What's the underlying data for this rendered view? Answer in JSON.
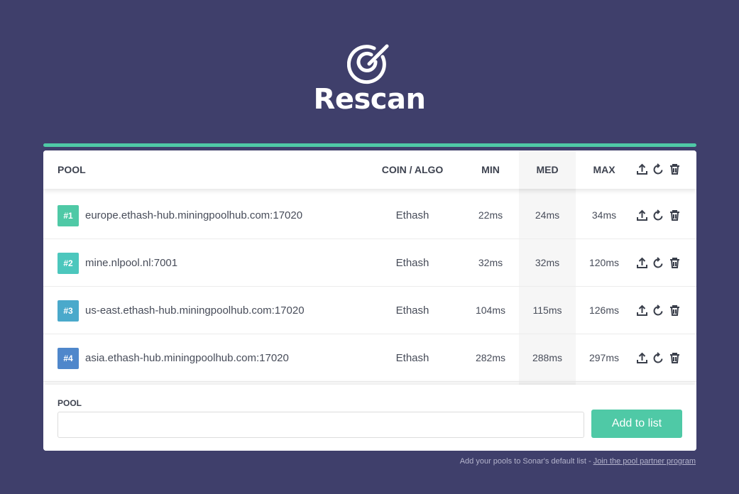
{
  "brand": {
    "name": "Rescan",
    "logo_icon": "radar-target-icon"
  },
  "colors": {
    "background": "#3f3f6b",
    "accent": "#4fc9a6",
    "badge_colors": [
      "#4fc9a6",
      "#4cc7bd",
      "#4aa9cb",
      "#4f87cb"
    ]
  },
  "table": {
    "headers": {
      "pool": "POOL",
      "coin": "COIN / ALGO",
      "min": "MIN",
      "med": "MED",
      "max": "MAX"
    },
    "header_actions": [
      "upload-icon",
      "refresh-icon",
      "trash-icon"
    ],
    "rows": [
      {
        "rank": "#1",
        "host": "europe.ethash-hub.miningpoolhub.com:17020",
        "coin": "Ethash",
        "min": "22ms",
        "med": "24ms",
        "max": "34ms"
      },
      {
        "rank": "#2",
        "host": "mine.nlpool.nl:7001",
        "coin": "Ethash",
        "min": "32ms",
        "med": "32ms",
        "max": "120ms"
      },
      {
        "rank": "#3",
        "host": "us-east.ethash-hub.miningpoolhub.com:17020",
        "coin": "Ethash",
        "min": "104ms",
        "med": "115ms",
        "max": "126ms"
      },
      {
        "rank": "#4",
        "host": "asia.ethash-hub.miningpoolhub.com:17020",
        "coin": "Ethash",
        "min": "282ms",
        "med": "288ms",
        "max": "297ms"
      }
    ]
  },
  "add_form": {
    "label": "POOL",
    "input_value": "",
    "button_label": "Add to list"
  },
  "footer": {
    "text": "Add your pools to Sonar's default list - ",
    "link_text": "Join the pool partner program"
  }
}
